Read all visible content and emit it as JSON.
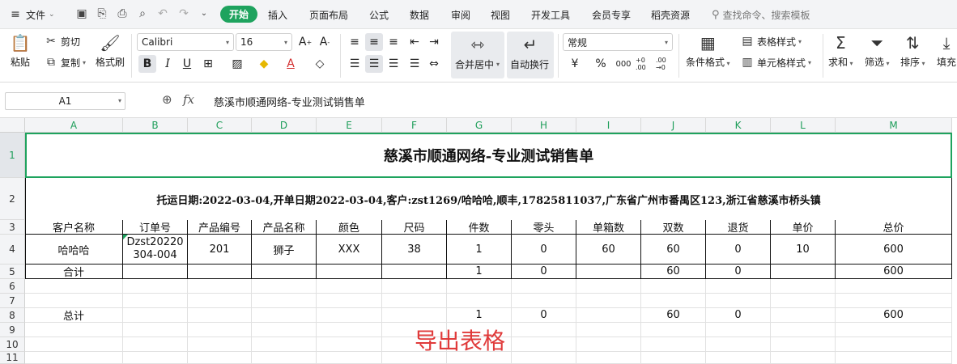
{
  "menubar": {
    "file_label": "文件",
    "tabs": [
      "开始",
      "插入",
      "页面布局",
      "公式",
      "数据",
      "审阅",
      "视图",
      "开发工具",
      "会员专享",
      "稻壳资源"
    ],
    "active_tab": "开始",
    "search_placeholder": "查找命令、搜索模板"
  },
  "ribbon": {
    "paste": "粘贴",
    "cut": "剪切",
    "copy": "复制",
    "format_painter": "格式刷",
    "font_name": "Calibri",
    "font_size": "16",
    "merge_center": "合并居中",
    "wrap_text": "自动换行",
    "number_format": "常规",
    "conditional_format": "条件格式",
    "table_style": "表格样式",
    "cell_style": "单元格样式",
    "sum": "求和",
    "filter": "筛选",
    "sort": "排序",
    "fill": "填充",
    "currency_symbol": "¥",
    "percent_symbol": "%",
    "thousands_symbol": "000",
    "inc_decimal": "+0 .00",
    "dec_decimal": ".00 →0"
  },
  "formula_bar": {
    "cell_ref": "A1",
    "fx_label": "fx",
    "content": "慈溪市顺通网络-专业测试销售单"
  },
  "sheet": {
    "columns": [
      "A",
      "B",
      "C",
      "D",
      "E",
      "F",
      "G",
      "H",
      "I",
      "J",
      "K",
      "L",
      "M"
    ],
    "row_numbers": [
      "1",
      "2",
      "3",
      "4",
      "5",
      "6",
      "7",
      "8",
      "9",
      "10",
      "11"
    ],
    "title": "慈溪市顺通网络-专业测试销售单",
    "subtitle": "托运日期:2022-03-04,开单日期2022-03-04,客户:zst1269/哈哈哈,顺丰,17825811037,广东省广州市番禺区123,浙江省慈溪市桥头镇",
    "headers": [
      "客户名称",
      "订单号",
      "产品编号",
      "产品名称",
      "颜色",
      "尺码",
      "件数",
      "零头",
      "单箱数",
      "双数",
      "退货",
      "单价",
      "总价"
    ],
    "row4": [
      "哈哈哈",
      "Dzst20220304-004",
      "201",
      "狮子",
      "XXX",
      "38",
      "1",
      "0",
      "60",
      "60",
      "0",
      "10",
      "600"
    ],
    "row5": [
      "合计",
      "",
      "",
      "",
      "",
      "",
      "1",
      "0",
      "",
      "60",
      "0",
      "",
      "600"
    ],
    "row8": [
      "总计",
      "",
      "",
      "",
      "",
      "",
      "1",
      "0",
      "",
      "60",
      "0",
      "",
      "600"
    ],
    "order_line1": "Dzst20220",
    "order_line2": "304-004"
  },
  "overlay_text": "导出表格",
  "colors": {
    "accent_green": "#1ea35e",
    "overlay_red": "#e03a3a"
  }
}
